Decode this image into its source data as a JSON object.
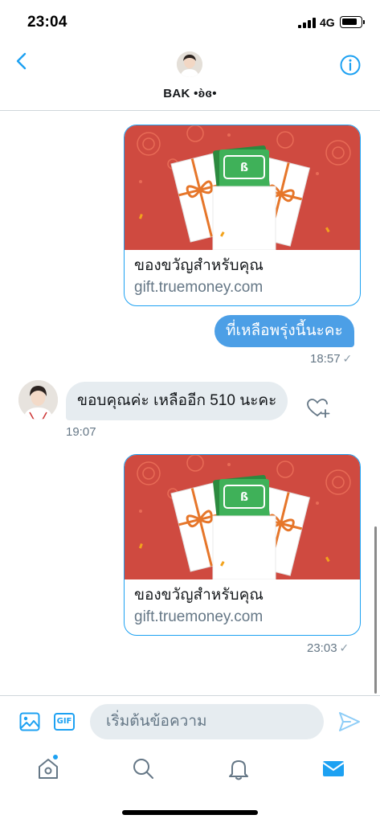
{
  "status_bar": {
    "time": "23:04",
    "network": "4G",
    "battery_level": 0.88
  },
  "header": {
    "name": "BAK •ʚ̀ɞ•"
  },
  "messages": [
    {
      "type": "card",
      "title": "ของขวัญสำหรับคุณ",
      "url": "gift.truemoney.com"
    },
    {
      "type": "sent",
      "text": "ที่เหลือพรุ่งนี้นะคะ",
      "time": "18:57"
    },
    {
      "type": "received",
      "text": "ขอบคุณค่ะ เหลืออีก 510 นะคะ",
      "time": "19:07"
    },
    {
      "type": "card",
      "title": "ของขวัญสำหรับคุณ",
      "url": "gift.truemoney.com",
      "time": "23:03"
    }
  ],
  "composer": {
    "placeholder": "เริ่มต้นข้อความ",
    "gif_label": "GIF"
  },
  "colors": {
    "accent": "#1da1f2",
    "sent_bubble": "#4c9fe6",
    "received_bubble": "#e6ecf0",
    "card_image": "#cf4a40"
  },
  "icons": [
    "back-icon",
    "info-icon",
    "heart-plus-icon",
    "image-icon",
    "gif-icon",
    "send-icon",
    "home-icon",
    "search-icon",
    "bell-icon",
    "mail-icon"
  ]
}
